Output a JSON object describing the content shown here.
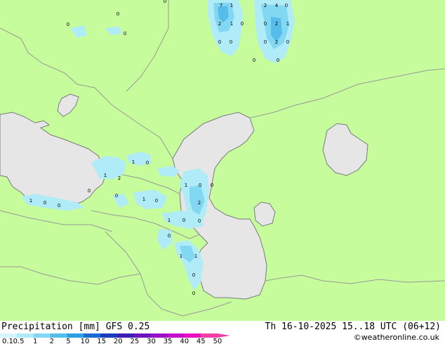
{
  "map": {
    "colors": {
      "land": "#c6fc9b",
      "sea": "#e6e6e6",
      "precip_light": "#b0ecf8",
      "precip_mid": "#82d8f2",
      "precip_heavy": "#56bcea",
      "border": "#999999",
      "coast": "#7a7a7a"
    },
    "point_values": [
      {
        "id": "v1",
        "text": "7"
      },
      {
        "id": "v2",
        "text": "1"
      },
      {
        "id": "v3",
        "text": "2"
      },
      {
        "id": "v4",
        "text": "4"
      },
      {
        "id": "v5",
        "text": "0"
      },
      {
        "id": "v6",
        "text": "2"
      },
      {
        "id": "v7",
        "text": "1"
      },
      {
        "id": "v8",
        "text": "0"
      },
      {
        "id": "v9",
        "text": "0"
      },
      {
        "id": "v10",
        "text": "2"
      },
      {
        "id": "v11",
        "text": "1"
      },
      {
        "id": "v12",
        "text": "0"
      },
      {
        "id": "v13",
        "text": "0"
      },
      {
        "id": "v14",
        "text": "0"
      },
      {
        "id": "v15",
        "text": "2"
      },
      {
        "id": "v16",
        "text": "0"
      },
      {
        "id": "v17",
        "text": "0"
      },
      {
        "id": "v18",
        "text": "0"
      },
      {
        "id": "v19",
        "text": "0"
      },
      {
        "id": "v20",
        "text": "0"
      },
      {
        "id": "v21",
        "text": "0"
      },
      {
        "id": "v22",
        "text": "0"
      },
      {
        "id": "v23",
        "text": "1"
      },
      {
        "id": "v24",
        "text": "0"
      },
      {
        "id": "v25",
        "text": "1"
      },
      {
        "id": "v26",
        "text": "2"
      },
      {
        "id": "v27",
        "text": "0"
      },
      {
        "id": "v28",
        "text": "0"
      },
      {
        "id": "v29",
        "text": "1"
      },
      {
        "id": "v30",
        "text": "0"
      },
      {
        "id": "v31",
        "text": "0"
      },
      {
        "id": "v32",
        "text": "1"
      },
      {
        "id": "v33",
        "text": "0"
      },
      {
        "id": "v34",
        "text": "1"
      },
      {
        "id": "v35",
        "text": "0"
      },
      {
        "id": "v36",
        "text": "2"
      },
      {
        "id": "v37",
        "text": "0"
      },
      {
        "id": "v38",
        "text": "1"
      },
      {
        "id": "v39",
        "text": "0"
      },
      {
        "id": "v40",
        "text": "0"
      },
      {
        "id": "v41",
        "text": "0"
      },
      {
        "id": "v42",
        "text": "1"
      },
      {
        "id": "v43",
        "text": "1"
      },
      {
        "id": "v44",
        "text": "0"
      },
      {
        "id": "v45",
        "text": "0"
      }
    ]
  },
  "footer": {
    "title": "Precipitation [mm] GFS 0.25",
    "datetime": "Th 16-10-2025 15..18 UTC (06+12)",
    "credit": "©weatheronline.co.uk",
    "legend": {
      "ticks": [
        "0.1",
        "0.5",
        "1",
        "2",
        "5",
        "10",
        "15",
        "20",
        "25",
        "30",
        "35",
        "40",
        "45",
        "50"
      ],
      "colors": [
        "#d6f6fc",
        "#b0ecf8",
        "#82d8f2",
        "#56bcea",
        "#2aa0e2",
        "#1a6cd0",
        "#1c3cc0",
        "#3a1cb6",
        "#6a14c0",
        "#9a10c8",
        "#c80ccc",
        "#e810c0",
        "#f040a8"
      ]
    }
  }
}
